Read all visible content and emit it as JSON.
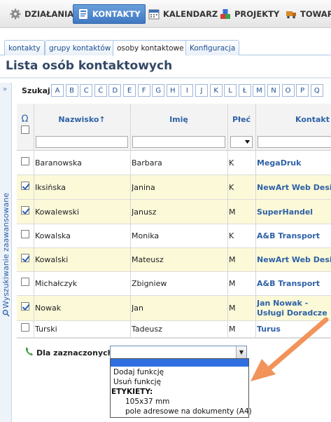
{
  "nav": {
    "items": [
      {
        "label": "DZIAŁANIA",
        "icon": "gear-icon",
        "active": false
      },
      {
        "label": "KONTAKTY",
        "icon": "contacts-book-icon",
        "active": true
      },
      {
        "label": "KALENDARZ",
        "icon": "calendar-icon",
        "active": false
      },
      {
        "label": "PROJEKTY",
        "icon": "projects-cubes-icon",
        "active": false
      },
      {
        "label": "TOWAR",
        "icon": "goods-truck-icon",
        "active": false
      }
    ]
  },
  "subtabs": [
    {
      "label": "kontakty",
      "active": false
    },
    {
      "label": "grupy kontaktów",
      "active": false
    },
    {
      "label": "osoby kontaktowe",
      "active": true
    },
    {
      "label": "Konfiguracja",
      "active": false
    }
  ],
  "page_title": "Lista osób kontaktowych",
  "sidebar": {
    "label": "Wyszukiwanie zaawansowane",
    "icon": "search-icon"
  },
  "search": {
    "label": "Szukaj:",
    "letters": [
      "A",
      "B",
      "C",
      "Ć",
      "D",
      "E",
      "F",
      "G",
      "H",
      "I",
      "J",
      "K",
      "L",
      "Ł",
      "M",
      "N",
      "O",
      "P",
      "Q"
    ]
  },
  "table": {
    "columns": [
      "Nazwisko↑",
      "Imię",
      "Płeć",
      "Kontakt"
    ],
    "header_icon": "omega-columns-icon",
    "rows": [
      {
        "nazwisko": "Baranowska",
        "imie": "Barbara",
        "plec": "K",
        "kontakt": "MegaDruk",
        "checked": false
      },
      {
        "nazwisko": "Iksińska",
        "imie": "Janina",
        "plec": "K",
        "kontakt": "NewArt Web Design",
        "checked": true
      },
      {
        "nazwisko": "Kowalewski",
        "imie": "Janusz",
        "plec": "M",
        "kontakt": "SuperHandel",
        "checked": true
      },
      {
        "nazwisko": "Kowalska",
        "imie": "Monika",
        "plec": "K",
        "kontakt": "A&B Transport",
        "checked": false
      },
      {
        "nazwisko": "Kowalski",
        "imie": "Mateusz",
        "plec": "M",
        "kontakt": "NewArt Web Design",
        "checked": true
      },
      {
        "nazwisko": "Michałczyk",
        "imie": "Zbigniew",
        "plec": "M",
        "kontakt": "A&B Transport",
        "checked": false
      },
      {
        "nazwisko": "Nowak",
        "imie": "Jan",
        "plec": "M",
        "kontakt": "Jan Nowak - Usługi Doradcze",
        "checked": true
      },
      {
        "nazwisko": "Turski",
        "imie": "Tadeusz",
        "plec": "M",
        "kontakt": "Turus",
        "checked": false
      }
    ]
  },
  "bulk": {
    "label": "Dla zaznaczonych:",
    "icon": "phone-icon",
    "selected": "",
    "options": [
      {
        "label": "",
        "kind": "blank"
      },
      {
        "label": "Dodaj funkcję",
        "kind": "item"
      },
      {
        "label": "Usuń funkcję",
        "kind": "item"
      },
      {
        "label": "ETYKIETY:",
        "kind": "group"
      },
      {
        "label": "105x37 mm",
        "kind": "sub"
      },
      {
        "label": "pole adresowe na dokumenty (A4)",
        "kind": "sub"
      }
    ]
  },
  "colors": {
    "accent": "#3f78c2",
    "link": "#2f62a6",
    "selected_row": "#fbf9d8",
    "annotation_arrow": "#f2935a"
  }
}
